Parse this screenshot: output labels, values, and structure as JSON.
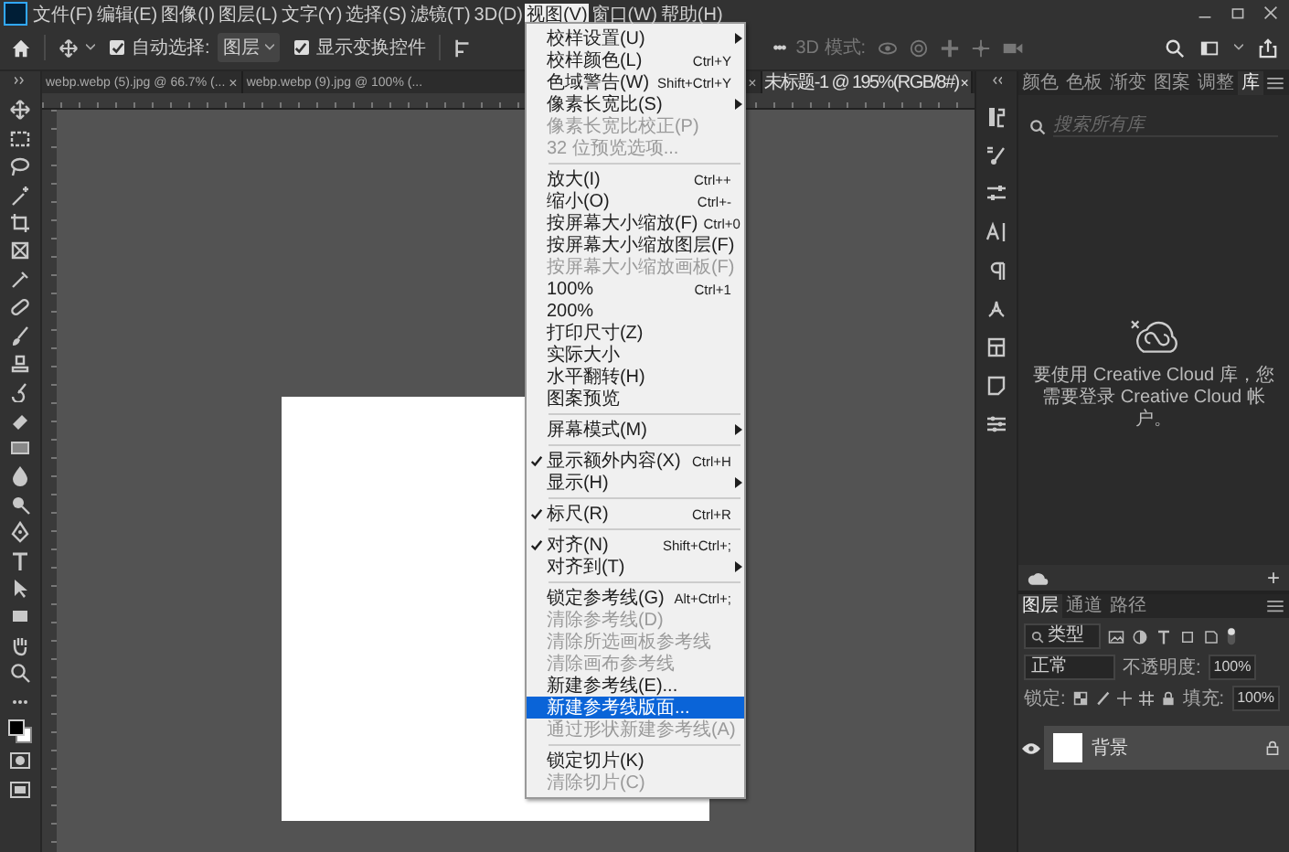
{
  "menubar": {
    "items": [
      {
        "label": "文件(F)",
        "selected": false
      },
      {
        "label": "编辑(E)",
        "selected": false
      },
      {
        "label": "图像(I)",
        "selected": false
      },
      {
        "label": "图层(L)",
        "selected": false
      },
      {
        "label": "文字(Y)",
        "selected": false
      },
      {
        "label": "选择(S)",
        "selected": false
      },
      {
        "label": "滤镜(T)",
        "selected": false
      },
      {
        "label": "3D(D)",
        "selected": false
      },
      {
        "label": "视图(V)",
        "selected": true
      },
      {
        "label": "窗口(W)",
        "selected": false
      },
      {
        "label": "帮助(H)",
        "selected": false
      }
    ]
  },
  "view_menu": {
    "items": [
      {
        "kind": "item",
        "label": "校样设置(U)",
        "submenu": true,
        "checked": false,
        "disabled": false,
        "selected": false
      },
      {
        "kind": "item",
        "label": "校样颜色(L)",
        "shortcut": "Ctrl+Y",
        "submenu": false,
        "checked": false,
        "disabled": false,
        "selected": false
      },
      {
        "kind": "item",
        "label": "色域警告(W)",
        "shortcut": "Shift+Ctrl+Y",
        "submenu": false,
        "checked": false,
        "disabled": false,
        "selected": false
      },
      {
        "kind": "item",
        "label": "像素长宽比(S)",
        "submenu": true,
        "checked": false,
        "disabled": false,
        "selected": false
      },
      {
        "kind": "item",
        "label": "像素长宽比校正(P)",
        "submenu": false,
        "checked": false,
        "disabled": true,
        "selected": false
      },
      {
        "kind": "item",
        "label": "32 位预览选项...",
        "submenu": false,
        "checked": false,
        "disabled": true,
        "selected": false
      },
      {
        "kind": "separator"
      },
      {
        "kind": "item",
        "label": "放大(I)",
        "shortcut": "Ctrl++",
        "submenu": false,
        "checked": false,
        "disabled": false,
        "selected": false
      },
      {
        "kind": "item",
        "label": "缩小(O)",
        "shortcut": "Ctrl+-",
        "submenu": false,
        "checked": false,
        "disabled": false,
        "selected": false
      },
      {
        "kind": "item",
        "label": "按屏幕大小缩放(F)",
        "shortcut": "Ctrl+0",
        "submenu": false,
        "checked": false,
        "disabled": false,
        "selected": false
      },
      {
        "kind": "item",
        "label": "按屏幕大小缩放图层(F)",
        "submenu": false,
        "checked": false,
        "disabled": false,
        "selected": false
      },
      {
        "kind": "item",
        "label": "按屏幕大小缩放画板(F)",
        "submenu": false,
        "checked": false,
        "disabled": true,
        "selected": false
      },
      {
        "kind": "item",
        "label": "100%",
        "shortcut": "Ctrl+1",
        "submenu": false,
        "checked": false,
        "disabled": false,
        "selected": false
      },
      {
        "kind": "item",
        "label": "200%",
        "submenu": false,
        "checked": false,
        "disabled": false,
        "selected": false
      },
      {
        "kind": "item",
        "label": "打印尺寸(Z)",
        "submenu": false,
        "checked": false,
        "disabled": false,
        "selected": false
      },
      {
        "kind": "item",
        "label": "实际大小",
        "submenu": false,
        "checked": false,
        "disabled": false,
        "selected": false
      },
      {
        "kind": "item",
        "label": "水平翻转(H)",
        "submenu": false,
        "checked": false,
        "disabled": false,
        "selected": false
      },
      {
        "kind": "item",
        "label": "图案预览",
        "submenu": false,
        "checked": false,
        "disabled": false,
        "selected": false
      },
      {
        "kind": "separator"
      },
      {
        "kind": "item",
        "label": "屏幕模式(M)",
        "submenu": true,
        "checked": false,
        "disabled": false,
        "selected": false
      },
      {
        "kind": "separator"
      },
      {
        "kind": "item",
        "label": "显示额外内容(X)",
        "shortcut": "Ctrl+H",
        "submenu": false,
        "checked": true,
        "disabled": false,
        "selected": false
      },
      {
        "kind": "item",
        "label": "显示(H)",
        "submenu": true,
        "checked": false,
        "disabled": false,
        "selected": false
      },
      {
        "kind": "separator"
      },
      {
        "kind": "item",
        "label": "标尺(R)",
        "shortcut": "Ctrl+R",
        "submenu": false,
        "checked": true,
        "disabled": false,
        "selected": false
      },
      {
        "kind": "separator"
      },
      {
        "kind": "item",
        "label": "对齐(N)",
        "shortcut": "Shift+Ctrl+;",
        "submenu": false,
        "checked": true,
        "disabled": false,
        "selected": false
      },
      {
        "kind": "item",
        "label": "对齐到(T)",
        "submenu": true,
        "checked": false,
        "disabled": false,
        "selected": false
      },
      {
        "kind": "separator"
      },
      {
        "kind": "item",
        "label": "锁定参考线(G)",
        "shortcut": "Alt+Ctrl+;",
        "submenu": false,
        "checked": false,
        "disabled": false,
        "selected": false
      },
      {
        "kind": "item",
        "label": "清除参考线(D)",
        "submenu": false,
        "checked": false,
        "disabled": true,
        "selected": false
      },
      {
        "kind": "item",
        "label": "清除所选画板参考线",
        "submenu": false,
        "checked": false,
        "disabled": true,
        "selected": false
      },
      {
        "kind": "item",
        "label": "清除画布参考线",
        "submenu": false,
        "checked": false,
        "disabled": true,
        "selected": false
      },
      {
        "kind": "item",
        "label": "新建参考线(E)...",
        "submenu": false,
        "checked": false,
        "disabled": false,
        "selected": false
      },
      {
        "kind": "item",
        "label": "新建参考线版面...",
        "submenu": false,
        "checked": false,
        "disabled": false,
        "selected": true
      },
      {
        "kind": "item",
        "label": "通过形状新建参考线(A)",
        "submenu": false,
        "checked": false,
        "disabled": true,
        "selected": false
      },
      {
        "kind": "separator"
      },
      {
        "kind": "item",
        "label": "锁定切片(K)",
        "submenu": false,
        "checked": false,
        "disabled": false,
        "selected": false
      },
      {
        "kind": "item",
        "label": "清除切片(C)",
        "submenu": false,
        "checked": false,
        "disabled": true,
        "selected": false
      }
    ]
  },
  "options_bar": {
    "auto_select": {
      "label": "自动选择:",
      "checked": true
    },
    "target": "图层",
    "show_transform": {
      "label": "显示变换控件",
      "checked": true
    },
    "more": "•••",
    "mode_3d": {
      "label": "3D 模式:",
      "disabled": true
    }
  },
  "document_tabs": [
    {
      "label": "webp.webp (5).jpg @ 66.7% (...",
      "close": "×",
      "selected": false
    },
    {
      "label": "webp.webp (9).jpg @ 100% (...",
      "close": "×",
      "selected": false
    },
    {
      "label": "未标题-1 @ 195%(RGB/8#)",
      "close": "×",
      "selected": true
    }
  ],
  "library_panel": {
    "tabs": [
      {
        "label": "颜色",
        "selected": false
      },
      {
        "label": "色板",
        "selected": false
      },
      {
        "label": "渐变",
        "selected": false
      },
      {
        "label": "图案",
        "selected": false
      },
      {
        "label": "调整",
        "selected": false
      },
      {
        "label": "库",
        "selected": true
      }
    ],
    "search": {
      "placeholder": "搜索所有库"
    },
    "message": "要使用 Creative Cloud 库，您需要登录 Creative Cloud 帐户。",
    "add": "+"
  },
  "layers_panel": {
    "tabs": [
      {
        "label": "图层",
        "selected": true
      },
      {
        "label": "通道",
        "selected": false
      },
      {
        "label": "路径",
        "selected": false
      }
    ],
    "filter": "类型",
    "blend_mode": "正常",
    "opacity_label": "不透明度:",
    "opacity": "100%",
    "lock_label": "锁定:",
    "fill_label": "填充:",
    "fill": "100%",
    "layers": [
      {
        "name": "背景",
        "visible": true,
        "locked": true,
        "selected": true
      }
    ]
  }
}
